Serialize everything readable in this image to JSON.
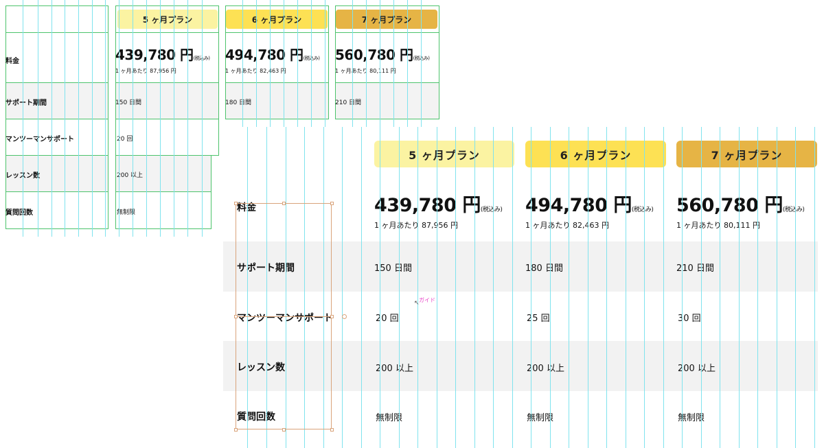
{
  "plans": [
    {
      "name": "5 ヶ月プラン",
      "price": "439,780 円",
      "tax": "(税込み)",
      "per_month": "1 ヶ月あたり 87,956 円",
      "support_period": "150 日間",
      "one_on_one": "20 回",
      "lessons": "200 以上",
      "questions": "無制限",
      "color": "#fbf3a2"
    },
    {
      "name": "6 ヶ月プラン",
      "price": "494,780 円",
      "tax": "(税込み)",
      "per_month": "1 ヶ月あたり 82,463 円",
      "support_period": "180 日間",
      "one_on_one": "25 回",
      "lessons": "200 以上",
      "questions": "無制限",
      "color": "#fde154"
    },
    {
      "name": "7 ヶ月プラン",
      "price": "560,780 円",
      "tax": "(税込み)",
      "per_month": "1 ヶ月あたり 80,111 円",
      "support_period": "210 日間",
      "one_on_one": "30 回",
      "lessons": "200 以上",
      "questions": "無制限",
      "color": "#e6b445"
    }
  ],
  "row_labels": {
    "price": "料金",
    "support_period": "サポート期間",
    "one_on_one": "マンツーマンサポート",
    "lessons": "レッスン数",
    "questions": "質問回数"
  },
  "guide_tooltip": "ガイド",
  "colors": {
    "guide": "#7fe3ee",
    "table_border": "#4cc36b",
    "selection": "#d9a37a",
    "shade": "#f2f2f2",
    "tooltip": "#e845c8"
  }
}
